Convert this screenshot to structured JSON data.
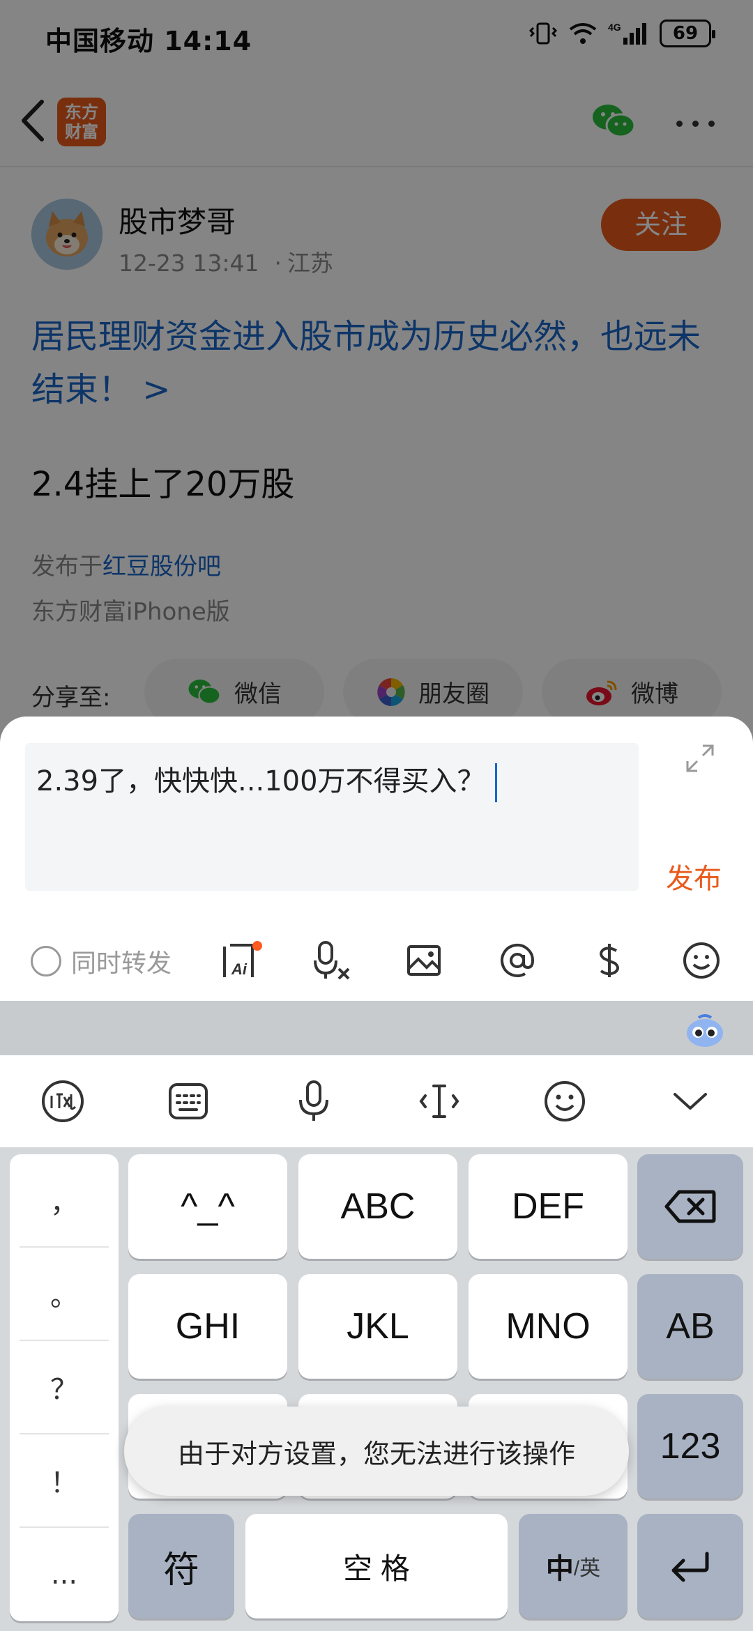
{
  "status_bar": {
    "carrier_time": "中国移动 14:14",
    "battery": "69",
    "network": "4G"
  },
  "nav": {
    "logo_line1": "东方",
    "logo_line2": "财富"
  },
  "post": {
    "author": "股市梦哥",
    "time": "12-23 13:41",
    "location": "江苏",
    "follow_label": "关注",
    "title": "居民理财资金进入股市成为历史必然，也远未结束！ >",
    "body": "2.4挂上了20万股",
    "origin_prefix": "发布于",
    "origin_bar": "红豆股份吧",
    "client": "东方财富iPhone版"
  },
  "share": {
    "label": "分享至:",
    "wechat": "微信",
    "moments": "朋友圈",
    "weibo": "微博"
  },
  "comment": {
    "text": "2.39了，快快快...100万不得买入？",
    "publish_label": "发布",
    "repost_label": "同时转发",
    "ai_label": "Ai"
  },
  "keyboard": {
    "punctuation": [
      "，",
      "。",
      "？",
      "！",
      "..."
    ],
    "row1": [
      "^_^",
      "ABC",
      "DEF"
    ],
    "row2": [
      "GHI",
      "JKL",
      "MNO",
      "AB"
    ],
    "row3_right": "123",
    "symbol_key": "符",
    "space_key": "空 格",
    "lang_key_main": "中",
    "lang_key_sub": "/英"
  },
  "toast": "由于对方设置，您无法进行该操作",
  "colors": {
    "brand_orange": "#e85a1c",
    "link_blue": "#1a66c8",
    "key_gray": "#a8b2c3"
  }
}
